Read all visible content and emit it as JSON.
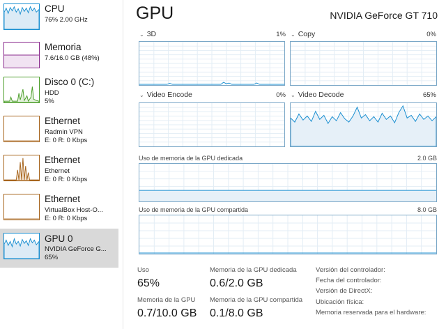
{
  "sidebar": {
    "items": [
      {
        "title": "CPU",
        "line1": "76% 2.00 GHz",
        "line2": "",
        "color": "#1a8fd1"
      },
      {
        "title": "Memoria",
        "line1": "7.6/16.0 GB (48%)",
        "line2": "",
        "color": "#8b2c8e"
      },
      {
        "title": "Disco 0 (C:)",
        "line1": "HDD",
        "line2": "5%",
        "color": "#4d9e2b"
      },
      {
        "title": "Ethernet",
        "line1": "Radmin VPN",
        "line2": "E: 0 R: 0 Kbps",
        "color": "#a7651d"
      },
      {
        "title": "Ethernet",
        "line1": "Ethernet",
        "line2": "E: 0 R: 0 Kbps",
        "color": "#a7651d"
      },
      {
        "title": "Ethernet",
        "line1": "VirtualBox Host-O...",
        "line2": "E: 0 R: 0 Kbps",
        "color": "#a7651d"
      },
      {
        "title": "GPU 0",
        "line1": "NVIDIA GeForce G...",
        "line2": "65%",
        "color": "#1a8fd1"
      }
    ]
  },
  "header": {
    "title": "GPU",
    "gpu_name": "NVIDIA GeForce GT 710"
  },
  "engines": [
    {
      "name": "3D",
      "percent": "1%",
      "level": 0.01
    },
    {
      "name": "Copy",
      "percent": "0%",
      "level": 0.0
    },
    {
      "name": "Video Encode",
      "percent": "0%",
      "level": 0.0
    },
    {
      "name": "Video Decode",
      "percent": "65%",
      "level": 0.65
    }
  ],
  "memory_graphs": {
    "dedicated": {
      "label": "Uso de memoria de la GPU dedicada",
      "max": "2.0 GB",
      "level": 0.3
    },
    "shared": {
      "label": "Uso de memoria de la GPU compartida",
      "max": "8.0 GB",
      "level": 0.0125
    }
  },
  "stats": {
    "usage_label": "Uso",
    "usage_value": "65%",
    "dedicated_label": "Memoria de la GPU dedicada",
    "dedicated_value": "0.6/2.0 GB",
    "gpu_mem_label": "Memoria de la GPU",
    "gpu_mem_value": "0.7/10.0 GB",
    "shared_label": "Memoria de la GPU compartida",
    "shared_value": "0.1/8.0 GB"
  },
  "info": {
    "driver_version": "Versión del controlador:",
    "driver_date": "Fecha del controlador:",
    "directx_version": "Versión de DirectX:",
    "physical_location": "Ubicación física:",
    "reserved_memory": "Memoria reservada para el hardware:"
  },
  "colors": {
    "accent": "#1a8fd1",
    "graph_border": "#7aa7c7",
    "selected_bg": "#d9d9d9"
  }
}
